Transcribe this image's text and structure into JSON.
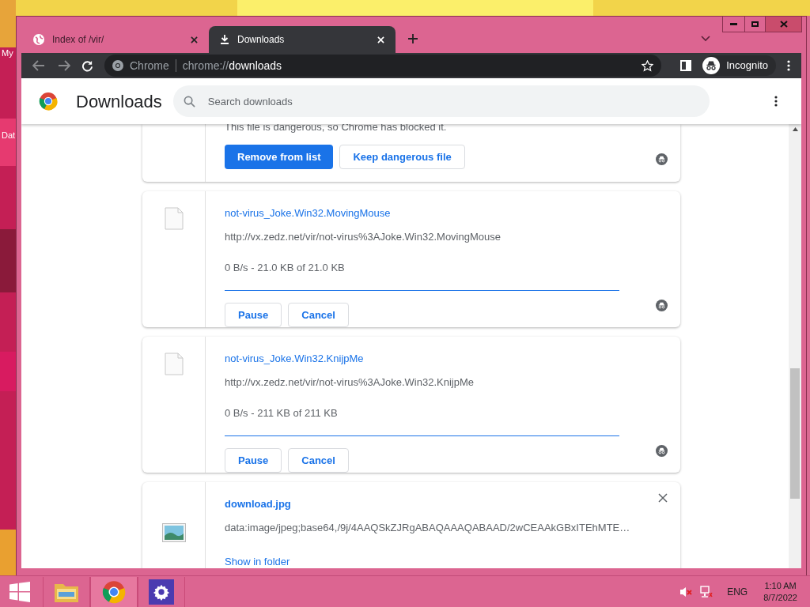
{
  "desktop": {
    "icons": [
      {
        "label": "My"
      },
      {
        "label": "Dat"
      }
    ]
  },
  "window": {
    "tabs": [
      {
        "title": "Index of /vir/",
        "selected": false
      },
      {
        "title": "Downloads",
        "selected": true
      }
    ]
  },
  "toolbar": {
    "site_label": "Chrome",
    "url_prefix": "chrome://",
    "url_host": "downloads",
    "profile": "Incognito"
  },
  "page": {
    "title": "Downloads",
    "search": {
      "placeholder": "Search downloads"
    }
  },
  "downloads": [
    {
      "kind": "dangerous",
      "warning": "This file is dangerous, so Chrome has blocked it.",
      "buttons": [
        {
          "label": "Remove from list",
          "primary": true
        },
        {
          "label": "Keep dangerous file",
          "primary": false
        }
      ],
      "incognito": true
    },
    {
      "kind": "in_progress",
      "name": "not-virus_Joke.Win32.MovingMouse",
      "url": "http://vx.zedz.net/vir/not-virus%3AJoke.Win32.MovingMouse",
      "status": "0 B/s - 21.0 KB of 21.0 KB",
      "level": 1,
      "buttons": [
        {
          "label": "Pause",
          "primary": false
        },
        {
          "label": "Cancel",
          "primary": false
        }
      ],
      "incognito": true
    },
    {
      "kind": "in_progress",
      "name": "not-virus_Joke.Win32.KnijpMe",
      "url": "http://vx.zedz.net/vir/not-virus%3AJoke.Win32.KnijpMe",
      "status": "0 B/s - 211 KB of 211 KB",
      "level": 1,
      "buttons": [
        {
          "label": "Pause",
          "primary": false
        },
        {
          "label": "Cancel",
          "primary": false
        }
      ],
      "incognito": true
    },
    {
      "kind": "complete",
      "name": "download.jpg",
      "url": "data:image/jpeg;base64,/9j/4AAQSkZJRgABAQAAAQABAAD/2wCEAAkGBxITEhMTE…",
      "link": "Show in folder",
      "incognito": false
    }
  ],
  "taskbar": {
    "apps": [
      {
        "kind": "explorer"
      },
      {
        "kind": "chrome"
      },
      {
        "kind": "settings"
      }
    ],
    "language": "ENG",
    "time": "1:10 AM",
    "date": "8/7/2022"
  }
}
